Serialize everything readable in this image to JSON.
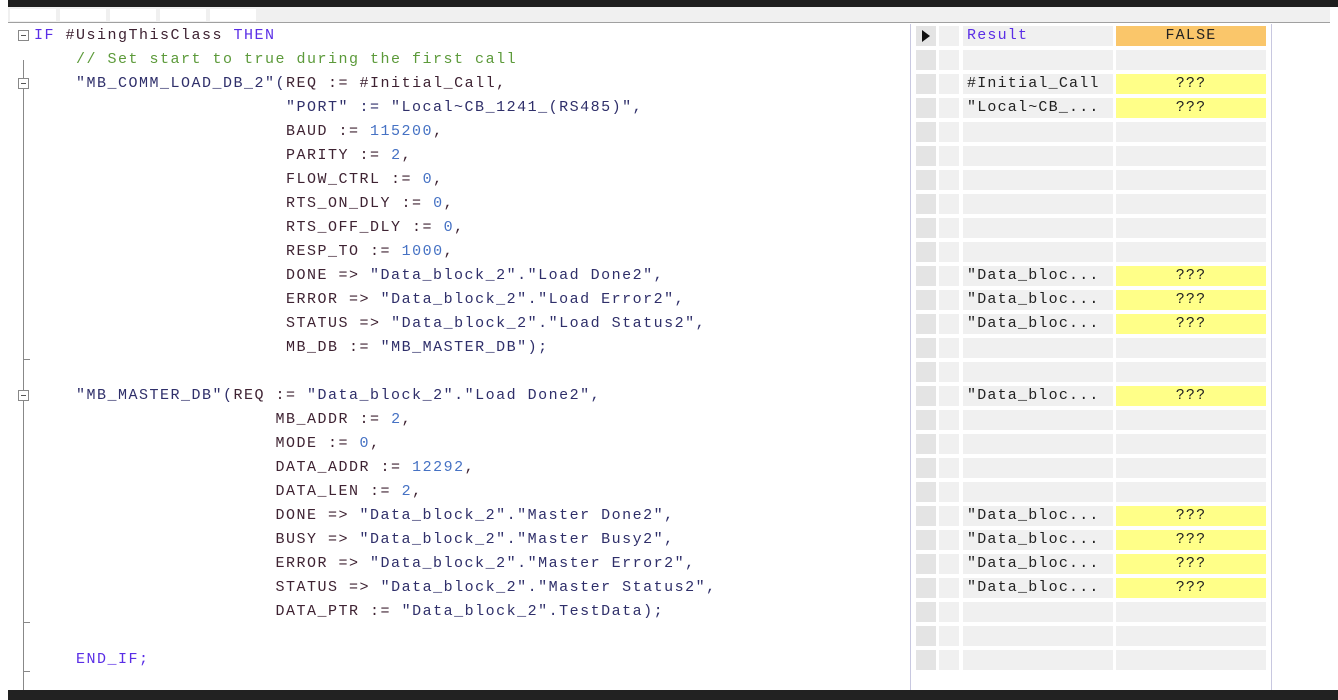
{
  "code_lines": [
    [
      [
        "kw",
        "IF "
      ],
      [
        "pn",
        "#UsingThisClass "
      ],
      [
        "kw",
        "THEN"
      ]
    ],
    [
      [
        "cm",
        "    // Set start to true during the first call"
      ]
    ],
    [
      [
        "st",
        "    \"MB_COMM_LOAD_DB_2\"("
      ],
      [
        "pn",
        "REQ := #Initial_Call,"
      ]
    ],
    [
      [
        "st",
        "                        \"PORT\" := \"Local~CB_1241_(RS485)\","
      ]
    ],
    [
      [
        "pn",
        "                        BAUD := "
      ],
      [
        "nu",
        "115200"
      ],
      [
        "op",
        ","
      ]
    ],
    [
      [
        "pn",
        "                        PARITY := "
      ],
      [
        "nu",
        "2"
      ],
      [
        "op",
        ","
      ]
    ],
    [
      [
        "pn",
        "                        FLOW_CTRL := "
      ],
      [
        "nu",
        "0"
      ],
      [
        "op",
        ","
      ]
    ],
    [
      [
        "pn",
        "                        RTS_ON_DLY := "
      ],
      [
        "nu",
        "0"
      ],
      [
        "op",
        ","
      ]
    ],
    [
      [
        "pn",
        "                        RTS_OFF_DLY := "
      ],
      [
        "nu",
        "0"
      ],
      [
        "op",
        ","
      ]
    ],
    [
      [
        "pn",
        "                        RESP_TO := "
      ],
      [
        "nu",
        "1000"
      ],
      [
        "op",
        ","
      ]
    ],
    [
      [
        "pn",
        "                        DONE => "
      ],
      [
        "st",
        "\"Data_block_2\".\"Load Done2\","
      ]
    ],
    [
      [
        "pn",
        "                        ERROR => "
      ],
      [
        "st",
        "\"Data_block_2\".\"Load Error2\","
      ]
    ],
    [
      [
        "pn",
        "                        STATUS => "
      ],
      [
        "st",
        "\"Data_block_2\".\"Load Status2\","
      ]
    ],
    [
      [
        "pn",
        "                        MB_DB := "
      ],
      [
        "st",
        "\"MB_MASTER_DB\");"
      ]
    ],
    [],
    [
      [
        "st",
        "    \"MB_MASTER_DB\"("
      ],
      [
        "pn",
        "REQ := "
      ],
      [
        "st",
        "\"Data_block_2\".\"Load Done2\","
      ]
    ],
    [
      [
        "pn",
        "                       MB_ADDR := "
      ],
      [
        "nu",
        "2"
      ],
      [
        "op",
        ","
      ]
    ],
    [
      [
        "pn",
        "                       MODE := "
      ],
      [
        "nu",
        "0"
      ],
      [
        "op",
        ","
      ]
    ],
    [
      [
        "pn",
        "                       DATA_ADDR := "
      ],
      [
        "nu",
        "12292"
      ],
      [
        "op",
        ","
      ]
    ],
    [
      [
        "pn",
        "                       DATA_LEN := "
      ],
      [
        "nu",
        "2"
      ],
      [
        "op",
        ","
      ]
    ],
    [
      [
        "pn",
        "                       DONE => "
      ],
      [
        "st",
        "\"Data_block_2\".\"Master Done2\","
      ]
    ],
    [
      [
        "pn",
        "                       BUSY => "
      ],
      [
        "st",
        "\"Data_block_2\".\"Master Busy2\","
      ]
    ],
    [
      [
        "pn",
        "                       ERROR => "
      ],
      [
        "st",
        "\"Data_block_2\".\"Master Error2\","
      ]
    ],
    [
      [
        "pn",
        "                       STATUS => "
      ],
      [
        "st",
        "\"Data_block_2\".\"Master Status2\","
      ]
    ],
    [
      [
        "pn",
        "                       DATA_PTR := "
      ],
      [
        "st",
        "\"Data_block_2\".TestData);"
      ]
    ],
    [],
    [
      [
        "kw",
        "    END_IF;"
      ]
    ]
  ],
  "monitor": {
    "header": {
      "name": "Result",
      "value": "FALSE"
    },
    "rows": {
      "2": {
        "name": "#Initial_Call",
        "value": "???"
      },
      "3": {
        "name": "\"Local~CB_...",
        "value": "???"
      },
      "10": {
        "name": "\"Data_bloc...",
        "value": "???"
      },
      "11": {
        "name": "\"Data_bloc...",
        "value": "???"
      },
      "12": {
        "name": "\"Data_bloc...",
        "value": "???"
      },
      "15": {
        "name": "\"Data_bloc...",
        "value": "???"
      },
      "20": {
        "name": "\"Data_bloc...",
        "value": "???"
      },
      "21": {
        "name": "\"Data_bloc...",
        "value": "???"
      },
      "22": {
        "name": "\"Data_bloc...",
        "value": "???"
      },
      "23": {
        "name": "\"Data_bloc...",
        "value": "???"
      }
    },
    "row_count": 27
  },
  "colors": {
    "header_value": "#fac66a",
    "unknown_value": "#ffff88",
    "keyword": "#5a2ee6",
    "comment": "#5c9a3a"
  }
}
